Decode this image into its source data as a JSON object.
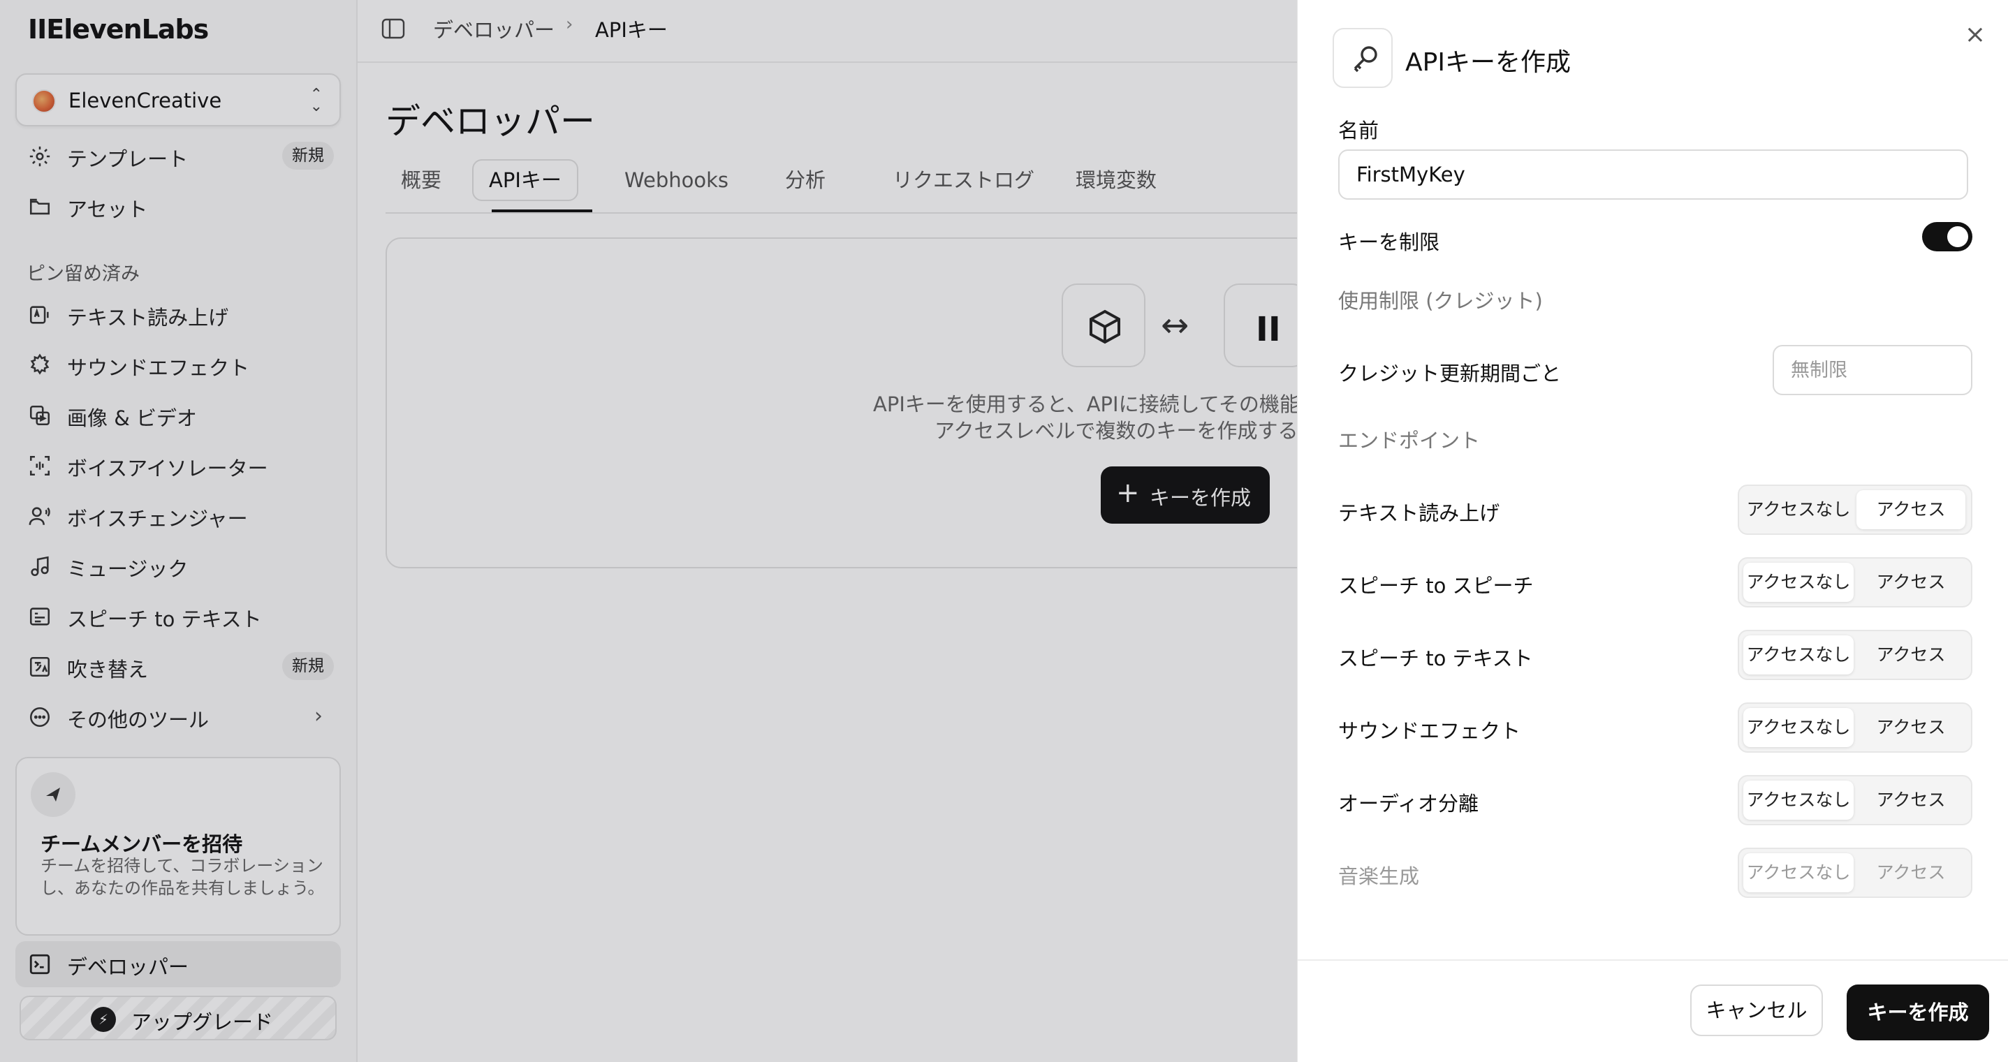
{
  "app": {
    "logo": "IIElevenLabs"
  },
  "workspace": {
    "name": "ElevenCreative"
  },
  "sidebar": {
    "top_items": [
      {
        "label": "テンプレート",
        "badge": "新規",
        "icon": "template-icon"
      },
      {
        "label": "アセット",
        "icon": "folder-icon"
      }
    ],
    "pinned_title": "ピン留め済み",
    "pinned_items": [
      {
        "label": "テキスト読み上げ",
        "icon": "text-to-speech-icon"
      },
      {
        "label": "サウンドエフェクト",
        "icon": "sound-effects-icon"
      },
      {
        "label": "画像 & ビデオ",
        "icon": "image-video-icon"
      },
      {
        "label": "ボイスアイソレーター",
        "icon": "voice-isolator-icon"
      },
      {
        "label": "ボイスチェンジャー",
        "icon": "voice-changer-icon"
      },
      {
        "label": "ミュージック",
        "icon": "music-icon"
      },
      {
        "label": "スピーチ to テキスト",
        "icon": "speech-to-text-icon"
      },
      {
        "label": "吹き替え",
        "badge": "新規",
        "icon": "dubbing-icon"
      },
      {
        "label": "その他のツール",
        "icon": "more-tools-icon"
      }
    ],
    "invite": {
      "title": "チームメンバーを招待",
      "description": "チームを招待して、コラボレーションし、あなたの作品を共有しましょう。"
    },
    "developer": "デベロッパー",
    "upgrade": "アップグレード"
  },
  "header": {
    "breadcrumb": [
      "デベロッパー",
      "APIキー"
    ]
  },
  "main": {
    "title": "デベロッパー",
    "tabs": [
      "概要",
      "APIキー",
      "Webhooks",
      "分析",
      "リクエストログ",
      "環境変数"
    ],
    "active_tab": "APIキー",
    "empty_state": {
      "line1": "APIキーを使用すると、APIに接続してその機能を",
      "line2": "アクセスレベルで複数のキーを作成するこ",
      "button": "キーを作成"
    }
  },
  "dialog": {
    "title": "APIキーを作成",
    "name_label": "名前",
    "name_value": "FirstMyKey",
    "restrict_label": "キーを制限",
    "restrict_on": true,
    "usage_limit_label": "使用制限 (クレジット)",
    "credit_period_label": "クレジット更新期間ごと",
    "credit_placeholder": "無制限",
    "endpoints_label": "エンドポイント",
    "option_none": "アクセスなし",
    "option_access": "アクセス",
    "endpoints": [
      {
        "label": "テキスト読み上げ",
        "selected": "アクセス"
      },
      {
        "label": "スピーチ to スピーチ",
        "selected": "アクセスなし"
      },
      {
        "label": "スピーチ to テキスト",
        "selected": "アクセスなし"
      },
      {
        "label": "サウンドエフェクト",
        "selected": "アクセスなし"
      },
      {
        "label": "オーディオ分離",
        "selected": "アクセスなし"
      },
      {
        "label": "音楽生成",
        "selected": "アクセスなし"
      }
    ],
    "cancel": "キャンセル",
    "create": "キーを作成"
  },
  "colors": {
    "primary": "#111111",
    "overlay": "#1c1c28",
    "badge_bg": "#ececec"
  }
}
